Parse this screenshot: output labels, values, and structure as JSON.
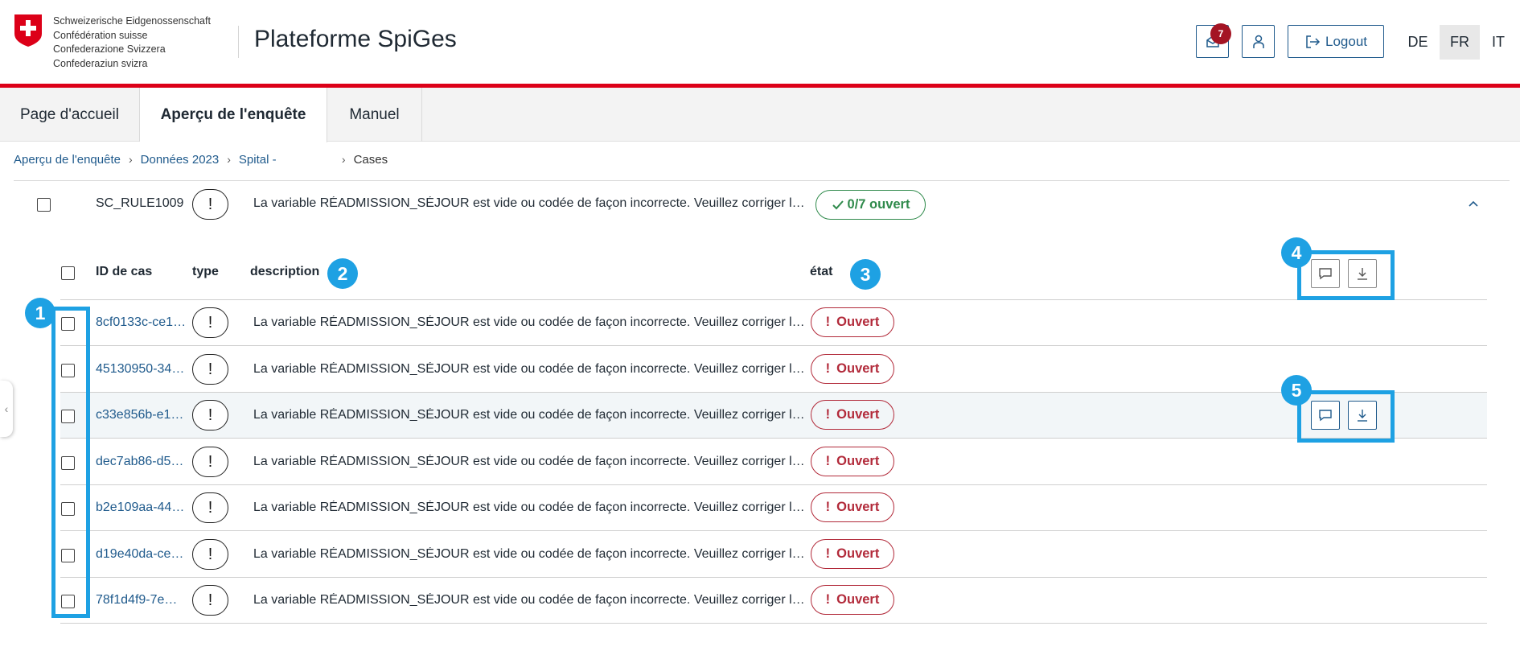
{
  "header": {
    "confederation_lines": [
      "Schweizerische Eidgenossenschaft",
      "Confédération suisse",
      "Confederazione Svizzera",
      "Confederaziun svizra"
    ],
    "app_title": "Plateforme SpiGes",
    "inbox_count": "7",
    "logout_label": "Logout",
    "languages": [
      "DE",
      "FR",
      "IT"
    ],
    "active_language": "FR"
  },
  "nav": {
    "tabs": [
      {
        "label": "Page d'accueil",
        "active": false
      },
      {
        "label": "Aperçu de l'enquête",
        "active": true
      },
      {
        "label": "Manuel",
        "active": false
      }
    ]
  },
  "breadcrumb": {
    "items": [
      "Aperçu de l'enquête",
      "Données 2023",
      "Spital -",
      "Cases"
    ],
    "separator": "›"
  },
  "rule": {
    "id": "SC_RULE1009",
    "type_symbol": "!",
    "description": "La variable RÉADMISSION_SÉJOUR est vide ou codée de façon incorrecte. Veuillez corriger les données.",
    "status": "0/7 ouvert",
    "status_color": "#2f8a4b"
  },
  "table": {
    "columns": [
      "ID de cas",
      "type",
      "description",
      "état"
    ],
    "rows": [
      {
        "case_id": "8cf0133c-ce1…",
        "type_symbol": "!",
        "description": "La variable RÉADMISSION_SÉJOUR est vide ou codée de façon incorrecte. Veuillez corriger les données.",
        "status": "Ouvert"
      },
      {
        "case_id": "45130950-34…",
        "type_symbol": "!",
        "description": "La variable RÉADMISSION_SÉJOUR est vide ou codée de façon incorrecte. Veuillez corriger les données.",
        "status": "Ouvert"
      },
      {
        "case_id": "c33e856b-e1…",
        "type_symbol": "!",
        "description": "La variable RÉADMISSION_SÉJOUR est vide ou codée de façon incorrecte. Veuillez corriger les données.",
        "status": "Ouvert"
      },
      {
        "case_id": "dec7ab86-d5…",
        "type_symbol": "!",
        "description": "La variable RÉADMISSION_SÉJOUR est vide ou codée de façon incorrecte. Veuillez corriger les données.",
        "status": "Ouvert"
      },
      {
        "case_id": "b2e109aa-44…",
        "type_symbol": "!",
        "description": "La variable RÉADMISSION_SÉJOUR est vide ou codée de façon incorrecte. Veuillez corriger les données.",
        "status": "Ouvert"
      },
      {
        "case_id": "d19e40da-ce…",
        "type_symbol": "!",
        "description": "La variable RÉADMISSION_SÉJOUR est vide ou codée de façon incorrecte. Veuillez corriger les données.",
        "status": "Ouvert"
      },
      {
        "case_id": "78f1d4f9-7e…",
        "type_symbol": "!",
        "description": "La variable RÉADMISSION_SÉJOUR est vide ou codée de façon incorrecte. Veuillez corriger les données.",
        "status": "Ouvert"
      }
    ],
    "open_status_color": "#b22a3a"
  },
  "annotations": [
    "1",
    "2",
    "3",
    "4",
    "5"
  ],
  "colors": {
    "brand_red": "#dc0018",
    "link_blue": "#1f5a8c",
    "annotation_blue": "#1ea1e3"
  },
  "icons": [
    "swiss-cross-icon",
    "inbox-icon",
    "user-icon",
    "logout-icon",
    "exclamation-icon",
    "check-icon",
    "chevron-up-icon",
    "comment-icon",
    "download-icon",
    "chevron-left-icon"
  ]
}
